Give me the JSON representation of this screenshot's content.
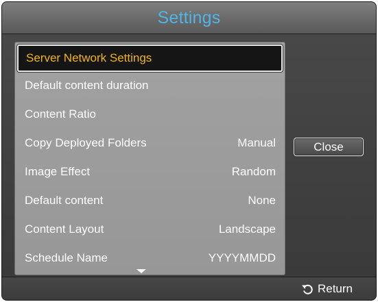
{
  "dialog": {
    "title": "Settings"
  },
  "menu": {
    "items": [
      {
        "label": "Server Network Settings",
        "value": "",
        "selected": true
      },
      {
        "label": "Default content duration",
        "value": ""
      },
      {
        "label": "Content Ratio",
        "value": ""
      },
      {
        "label": "Copy Deployed Folders",
        "value": "Manual"
      },
      {
        "label": "Image Effect",
        "value": "Random"
      },
      {
        "label": "Default content",
        "value": "None"
      },
      {
        "label": "Content Layout",
        "value": "Landscape"
      },
      {
        "label": "Schedule Name",
        "value": "YYYYMMDD"
      }
    ],
    "scroll_indicator_icon": "triangle-down-icon"
  },
  "close_button": {
    "label": "Close"
  },
  "footer": {
    "return_label": "Return",
    "return_icon": "return-arrow-icon"
  },
  "colors": {
    "title": "#4fb5e6",
    "selected_label": "#f2b417",
    "panel_background": "#9d9d9d",
    "dialog_background": "#3d3d3d"
  }
}
